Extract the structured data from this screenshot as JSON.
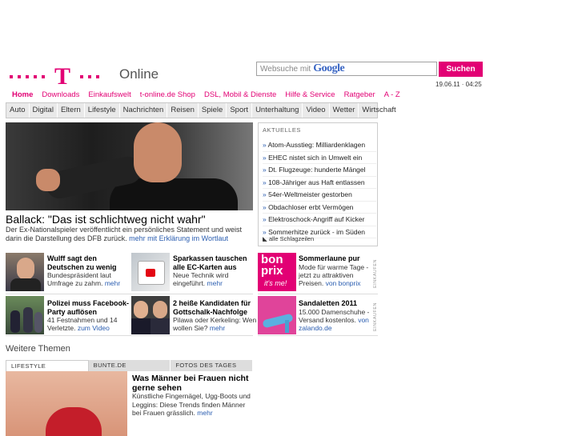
{
  "header": {
    "logo_t": "T",
    "brand_text": "Online",
    "search_placeholder": "Websuche mit",
    "search_engine_logo": "Google",
    "search_button": "Suchen",
    "datetime": "19.06.11 · 04:25"
  },
  "topnav": [
    "Home",
    "Downloads",
    "Einkaufswelt",
    "t-online.de Shop",
    "DSL, Mobil & Dienste",
    "Hilfe & Service",
    "Ratgeber",
    "A - Z"
  ],
  "categories": [
    "Auto",
    "Digital",
    "Eltern",
    "Lifestyle",
    "Nachrichten",
    "Reisen",
    "Spiele",
    "Sport",
    "Unterhaltung",
    "Video",
    "Wetter",
    "Wirtschaft"
  ],
  "hero": {
    "title": "Ballack: \"Das ist schlichtweg nicht wahr\"",
    "text": "Der Ex-Nationalspieler veröffentlicht ein persönliches Statement und weist darin die Darstellung des DFB zurück.",
    "more": "mehr mit Erklärung im Wortlaut"
  },
  "aktuelles": {
    "heading": "AKTUELLES",
    "items": [
      "Atom-Ausstieg: Milliardenklagen",
      "EHEC nistet sich in Umwelt ein",
      "Dt. Flugzeuge: hunderte Mängel",
      "108-Jähriger aus Haft entlassen",
      "54er-Weltmeister gestorben",
      "Obdachloser erbt Vermögen",
      "Elektroschock-Angriff auf Kicker",
      "Sommerhitze zurück - im Süden"
    ],
    "all_link": "alle Schlagzeilen"
  },
  "teasers": [
    {
      "title": "Wulff sagt den Deutschen zu wenig",
      "text": "Bundespräsident laut Umfrage zu zahm.",
      "more": "mehr"
    },
    {
      "title": "Sparkassen tauschen alle EC-Karten aus",
      "text": "Neue Technik wird eingeführt.",
      "more": "mehr"
    },
    {
      "title": "Polizei muss Facebook-Party auflösen",
      "text": "41 Festnahmen und 14 Verletzte.",
      "more": "zum Video"
    },
    {
      "title": "2 heiße Kandidaten für Gottschalk-Nachfolge",
      "text": "Pilawa oder Kerkeling: Wen wollen Sie?",
      "more": "mehr"
    }
  ],
  "ads": [
    {
      "logo1": "bon",
      "logo2": "prix",
      "logo3": "it's me!",
      "title": "Sommerlaune pur",
      "text": "Mode für warme Tage - jetzt zu attraktiven Preisen.",
      "more": "von bonprix",
      "label": "EINKAUFEN"
    },
    {
      "title": "Sandaletten 2011",
      "text": "15.000 Damenschuhe - Versand kostenlos.",
      "more": "von zalando.de",
      "label": "EINKAUFEN"
    }
  ],
  "weitere": {
    "heading": "Weitere Themen",
    "tabs": [
      "LIFESTYLE",
      "BUNTE.DE",
      "FOTOS DES TAGES"
    ],
    "title": "Was Männer bei Frauen nicht gerne sehen",
    "text": "Künstliche Fingernägel, Ugg-Boots und Leggins: Diese Trends finden Männer bei Frauen grässlich.",
    "more": "mehr"
  },
  "colors": {
    "brand": "#e20074",
    "link": "#2a5db0"
  }
}
